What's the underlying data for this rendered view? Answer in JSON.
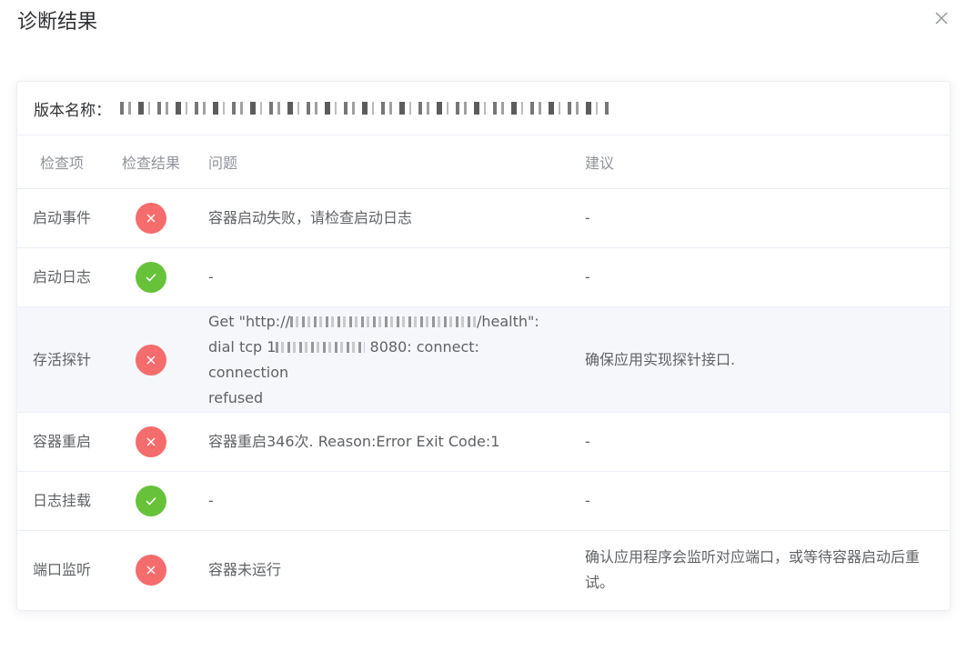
{
  "dialog": {
    "title": "诊断结果"
  },
  "version": {
    "label": "版本名称：",
    "value": "■■ ■ ■■ ■■■ ■■■ ■■■■ ■■ ■ ■■ ■■■ ■ ■■"
  },
  "table": {
    "headers": {
      "item": "检查项",
      "result": "检查结果",
      "problem": "问题",
      "suggestion": "建议"
    },
    "rows": [
      {
        "item": "启动事件",
        "result": "fail",
        "problem": "容器启动失败，请检查启动日志",
        "suggestion": "-"
      },
      {
        "item": "启动日志",
        "result": "pass",
        "problem": "-",
        "suggestion": "-"
      },
      {
        "item": "存活探针",
        "result": "fail",
        "problem_parts": {
          "a": "Get \"http://",
          "b": "/health\":",
          "c": "dial tcp 1",
          "d": "8080: connect: connection",
          "e": "refused"
        },
        "suggestion": "确保应用实现探针接口."
      },
      {
        "item": "容器重启",
        "result": "fail",
        "problem": "容器重启346次. Reason:Error Exit Code:1",
        "suggestion": "-"
      },
      {
        "item": "日志挂载",
        "result": "pass",
        "problem": "-",
        "suggestion": "-"
      },
      {
        "item": "端口监听",
        "result": "fail",
        "problem": "容器未运行",
        "suggestion": "确认应用程序会监听对应端口，或等待容器启动后重试。"
      }
    ]
  },
  "colors": {
    "fail": "#f56c6c",
    "pass": "#67c23a",
    "highlight_row": "#f5f7fa"
  },
  "icons": {
    "fail": "close-icon",
    "pass": "check-icon",
    "close": "close-icon"
  }
}
